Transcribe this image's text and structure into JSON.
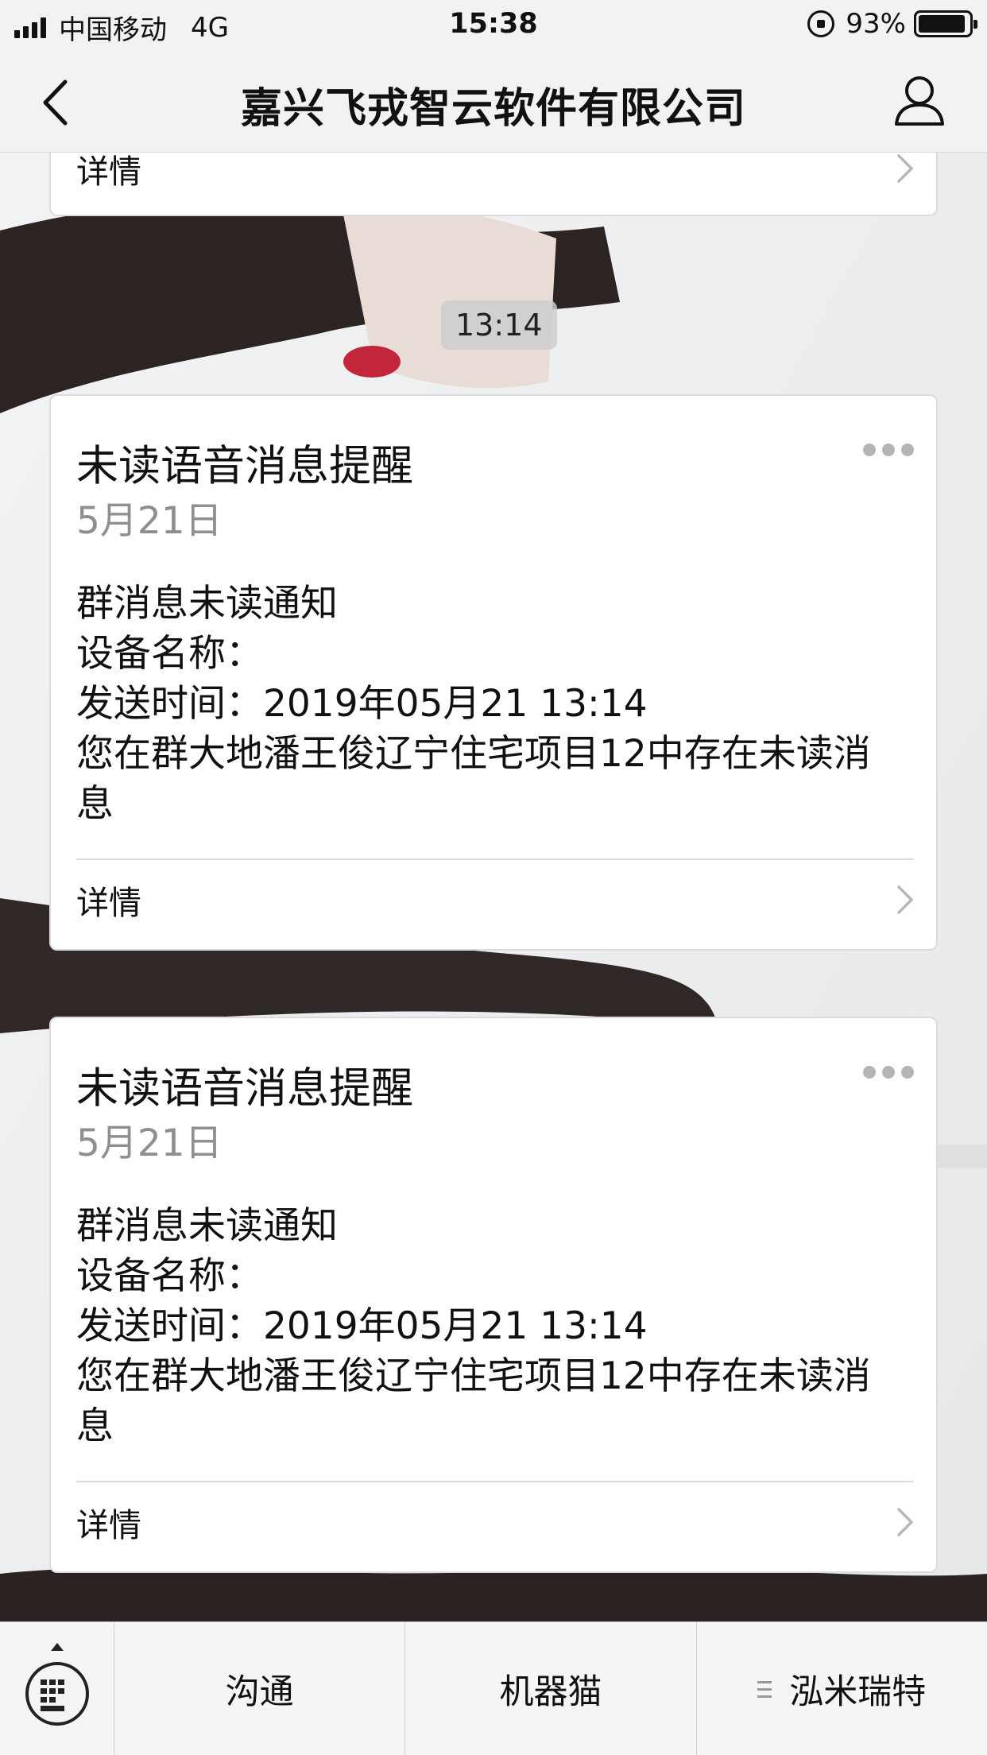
{
  "status_bar": {
    "carrier": "中国移动",
    "network": "4G",
    "time": "15:38",
    "battery": "93%"
  },
  "nav": {
    "title": "嘉兴飞戎智云软件有限公司",
    "back_icon": "chevron-left-icon",
    "profile_icon": "user-icon"
  },
  "chat": {
    "top_partial_card": {
      "link_label": "详情"
    },
    "timestamp": "13:14",
    "cards": [
      {
        "title": "未读语音消息提醒",
        "date": "5月21日",
        "lines": [
          "群消息未读通知",
          "设备名称：",
          "发送时间：2019年05月21 13:14",
          "您在群大地潘王俊辽宁住宅项目12中存在未读消息"
        ],
        "link_label": "详情"
      },
      {
        "title": "未读语音消息提醒",
        "date": "5月21日",
        "lines": [
          "群消息未读通知",
          "设备名称：",
          "发送时间：2019年05月21 13:14",
          "您在群大地潘王俊辽宁住宅项目12中存在未读消息"
        ],
        "link_label": "详情"
      }
    ]
  },
  "bottom_menu": {
    "keyboard_icon": "keyboard-icon",
    "items": [
      "沟通",
      "机器猫",
      "泓米瑞特"
    ]
  },
  "colors": {
    "bar_bg": "#f2f2f3",
    "card_bg": "#ffffff",
    "muted_text": "#8f8f8f"
  }
}
